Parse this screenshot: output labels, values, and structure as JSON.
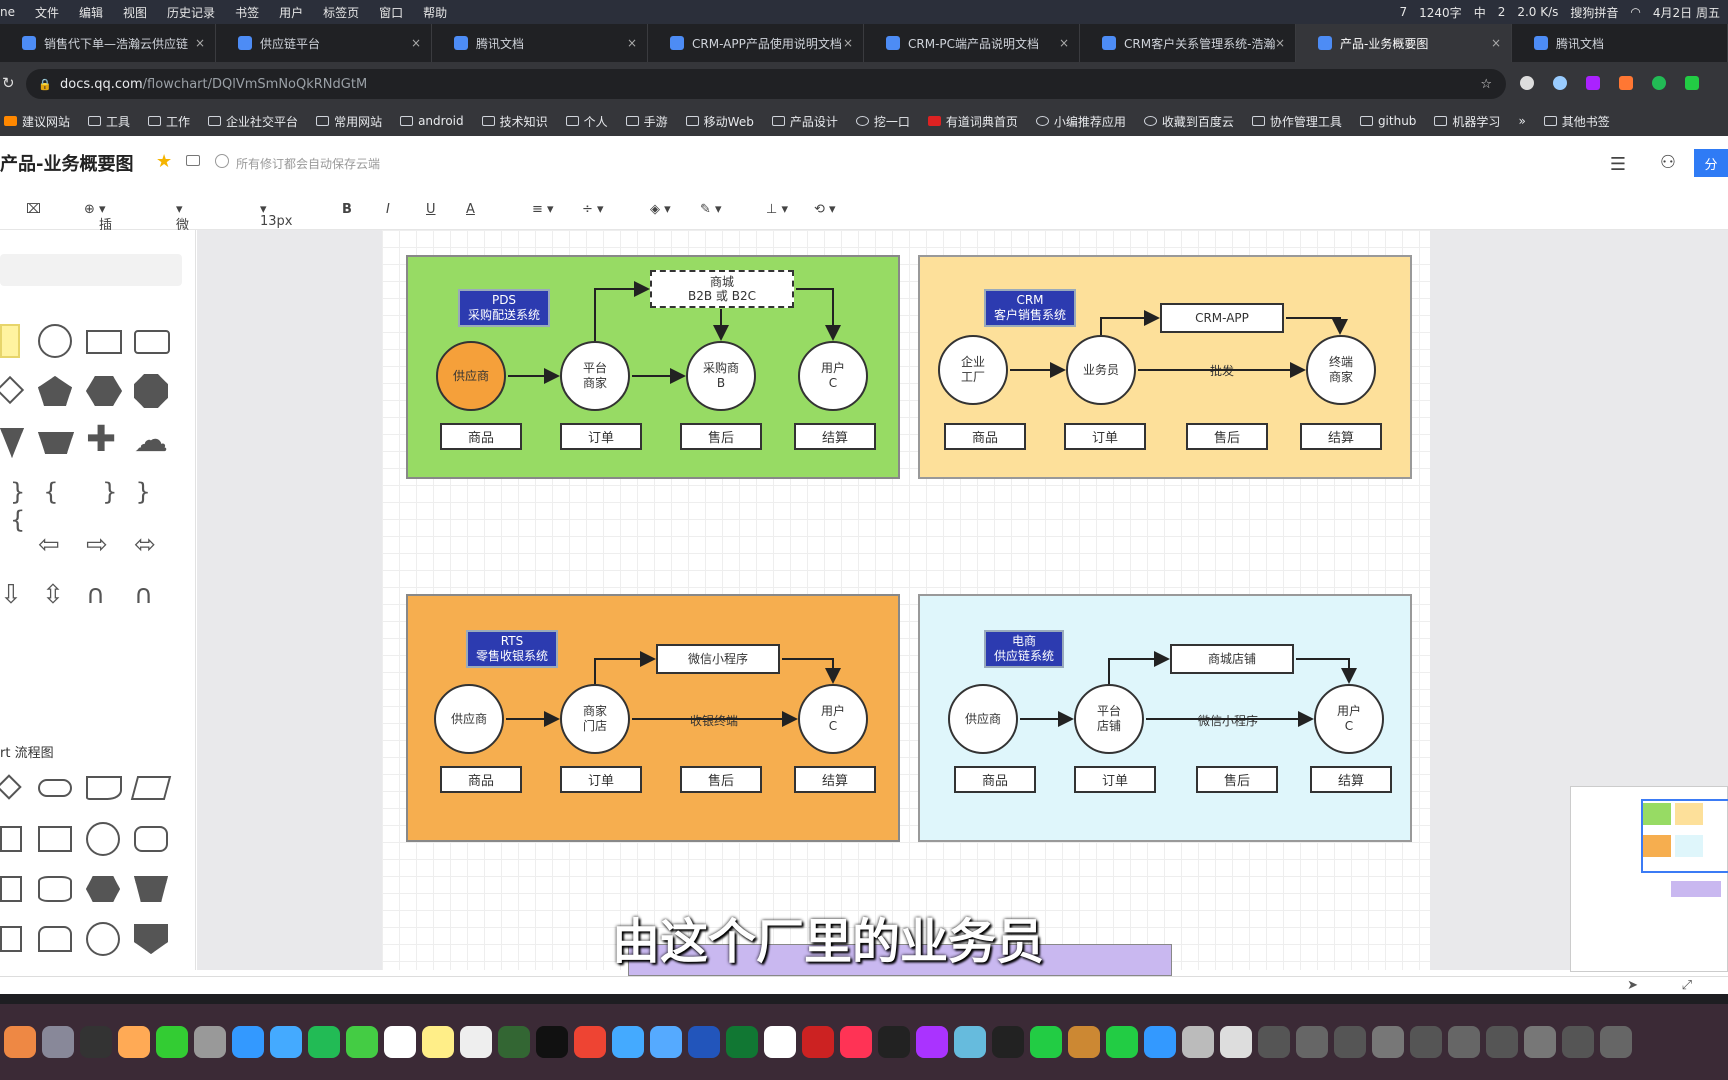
{
  "menubar": {
    "items": [
      "ne",
      "文件",
      "编辑",
      "视图",
      "历史记录",
      "书签",
      "用户",
      "标签页",
      "窗口",
      "帮助"
    ],
    "status": [
      "7",
      "1240字",
      "中",
      "2",
      "2.0 K/s",
      "搜狗拼音",
      "4月2日 周五"
    ]
  },
  "tabs": [
    {
      "label": "销售代下单—浩瀚云供应链"
    },
    {
      "label": "供应链平台"
    },
    {
      "label": "腾讯文档"
    },
    {
      "label": "CRM-APP产品使用说明文档"
    },
    {
      "label": "CRM-PC端产品说明文档"
    },
    {
      "label": "CRM客户关系管理系统-浩瀚"
    },
    {
      "label": "产品-业务概要图"
    },
    {
      "label": "腾讯文档"
    }
  ],
  "address": {
    "host": "docs.qq.com",
    "path": "/flowchart/DQlVmSmNoQkRNdGtM"
  },
  "bookmarks": [
    "建议网站",
    "工具",
    "工作",
    "企业社交平台",
    "常用网站",
    "android",
    "技术知识",
    "个人",
    "手游",
    "移动Web",
    "产品设计",
    "挖一口",
    "有道词典首页",
    "小编推荐应用",
    "收藏到百度云",
    "协作管理工具",
    "github",
    "机器学习",
    "»",
    "其他书签"
  ],
  "doc": {
    "title": "产品-业务概要图",
    "save_hint": "所有修订都会自动保存云端",
    "share": "分"
  },
  "toolbar": {
    "insert": "插入",
    "font": "微软雅黑",
    "size": "13px",
    "bold": "B",
    "italic": "I",
    "underline": "U",
    "fontcolor": "A"
  },
  "shapes": {
    "section_title": "rt 流程图"
  },
  "diagram": {
    "pds": {
      "tag": "PDS\n采购配送系统",
      "n1": "供应商",
      "n2": "平台\n商家",
      "n3": "采购商\nB",
      "n4": "用户\nC",
      "top": "商城\nB2B 或 B2C",
      "b": [
        "商品",
        "订单",
        "售后",
        "结算"
      ]
    },
    "crm": {
      "tag": "CRM\n客户销售系统",
      "n1": "企业\n工厂",
      "n2": "业务员",
      "n3": "终端\n商家",
      "top": "CRM-APP",
      "mid": "批发",
      "b": [
        "商品",
        "订单",
        "售后",
        "结算"
      ]
    },
    "rts": {
      "tag": "RTS\n零售收银系统",
      "n1": "供应商",
      "n2": "商家\n门店",
      "n3": "用户\nC",
      "top": "微信小程序",
      "mid": "收银终端",
      "b": [
        "商品",
        "订单",
        "售后",
        "结算"
      ]
    },
    "ec": {
      "tag": "电商\n供应链系统",
      "n1": "供应商",
      "n2": "平台\n店铺",
      "n3": "用户\nC",
      "top": "商城店铺",
      "mid": "微信小程序",
      "b": [
        "商品",
        "订单",
        "售后",
        "结算"
      ]
    }
  },
  "colors": {
    "pds": "#97db64",
    "crm": "#fde09a",
    "rts": "#f6ae4f",
    "ec": "#dff6fb",
    "orange_node": "#f5a03a",
    "tag": "#2c3bb0"
  },
  "subtitle": "由这个厂里的业务员"
}
